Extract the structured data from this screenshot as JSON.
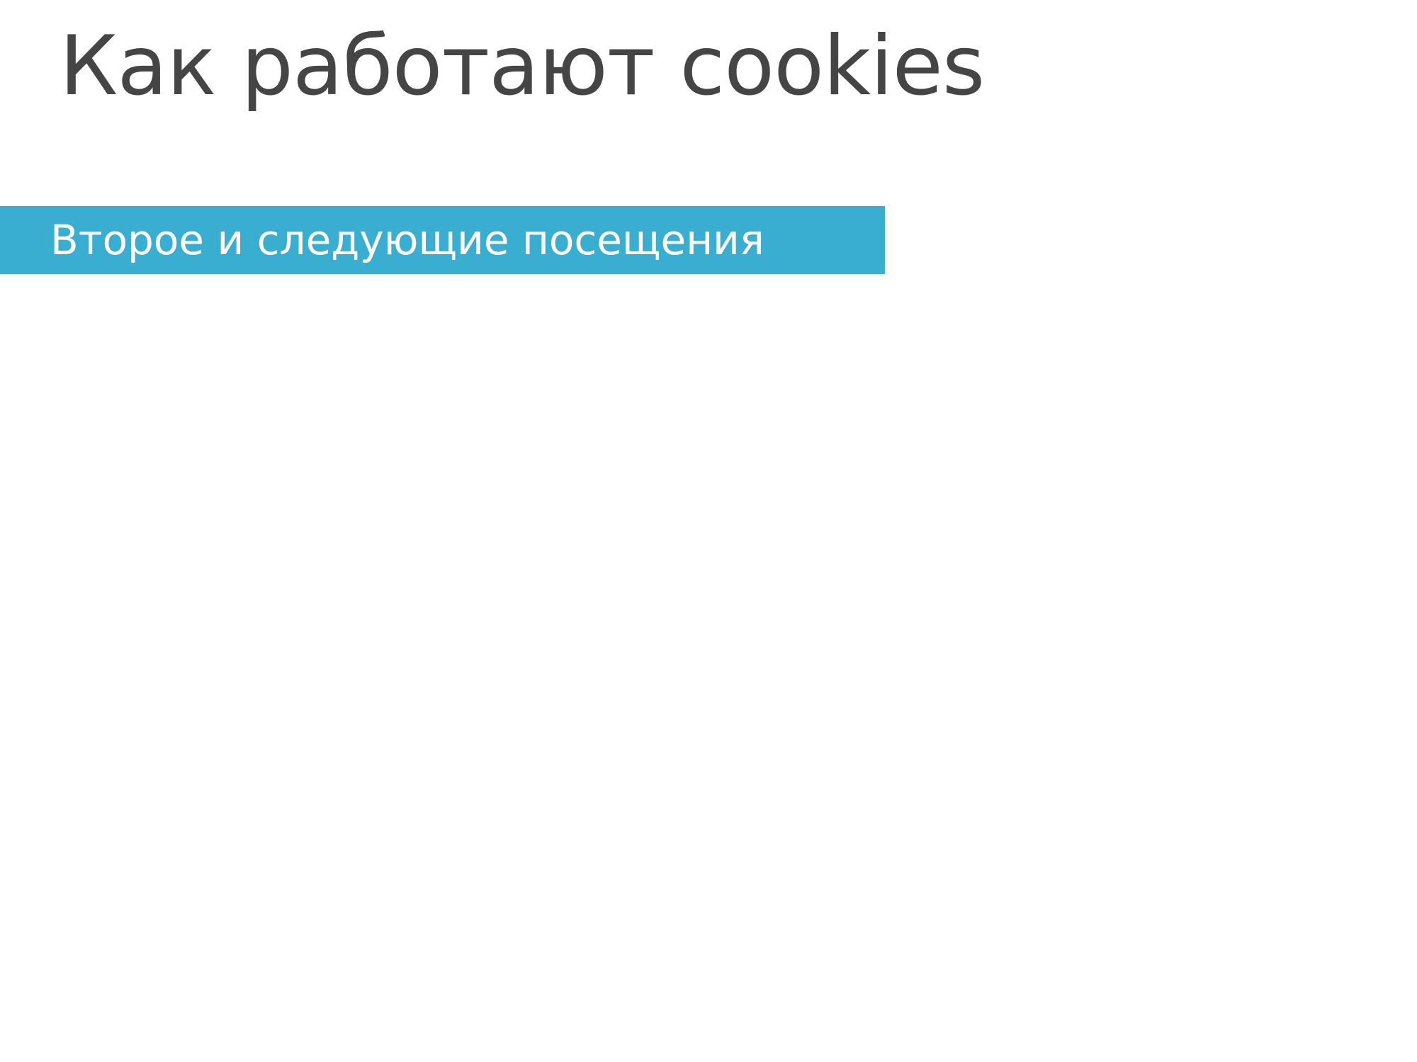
{
  "slide": {
    "title": "Как работают cookies",
    "section_label": "Второе и следующие посещения"
  },
  "colors": {
    "title_text": "#454545",
    "banner_background": "#3aaed0",
    "banner_text": "#ffffff",
    "page_background": "#ffffff"
  }
}
